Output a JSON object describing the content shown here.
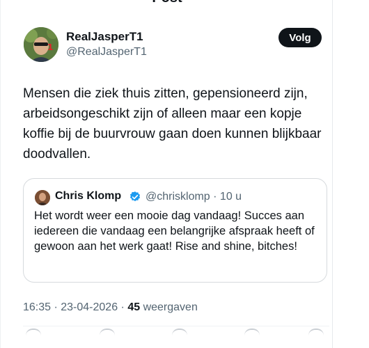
{
  "header": {
    "title": "Post"
  },
  "post": {
    "author_name": "RealJasperT1",
    "author_handle": "@RealJasperT1",
    "follow_label": "Volg",
    "text": "Mensen die ziek thuis zitten, gepensioneerd zijn, arbeidsongeschikt zijn of alleen maar een kopje koffie bij de buurvrouw gaan doen kunnen blijkbaar doodvallen.",
    "timestamp": "16:35 · 23-04-2026 · ",
    "views_count": "45",
    "views_label": " weergaven"
  },
  "quote": {
    "author_name": "Chris Klomp",
    "author_handle": "@chrisklomp · 10 u",
    "text": "Het wordt weer een mooie dag vandaag! Succes aan iedereen die vandaag een belangrijke afspraak heeft of gewoon aan het werk gaat! Rise and shine, bitches!"
  },
  "icons": {
    "verified": "verified-badge-icon",
    "reply": "reply-icon",
    "repost": "repost-icon",
    "like": "like-icon",
    "bookmark": "bookmark-icon",
    "share": "share-icon"
  },
  "colors": {
    "verified": "#1d9bf0",
    "follow_bg": "#0f1419",
    "secondary_text": "#536471"
  }
}
